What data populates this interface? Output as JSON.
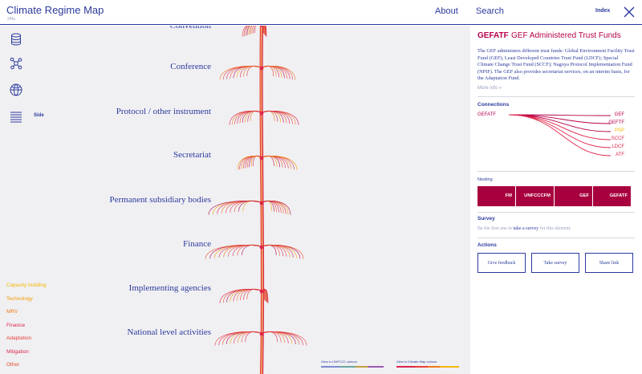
{
  "header": {
    "title": "Climate Regime Map",
    "subtitle": "24fa",
    "about_label": "About",
    "search_label": "Search",
    "index_label": "Index"
  },
  "sidebar": {
    "icons": [
      "database-icon",
      "network-icon",
      "globe-icon",
      "list-icon"
    ],
    "side_label": "Side"
  },
  "map": {
    "levels": [
      {
        "label": "Convention"
      },
      {
        "label": "Conference"
      },
      {
        "label": "Protocol / other instrument"
      },
      {
        "label": "Secretariat"
      },
      {
        "label": "Permanent subsidiary bodies"
      },
      {
        "label": "Finance"
      },
      {
        "label": "Implementing agencies"
      },
      {
        "label": "National level activities"
      }
    ],
    "view_unfccc_label": "View in UNFCCC colours",
    "view_crm_label": "View in Climate Map colours"
  },
  "legend": [
    {
      "label": "Capacity building",
      "color": "#f5b800"
    },
    {
      "label": "Technology",
      "color": "#f59a00"
    },
    {
      "label": "MRV",
      "color": "#ef7a1a"
    },
    {
      "label": "Finance",
      "color": "#e0264a"
    },
    {
      "label": "Adaptation",
      "color": "#e8403c"
    },
    {
      "label": "Mitigation",
      "color": "#d9254d"
    },
    {
      "label": "Other",
      "color": "#e84f2a"
    }
  ],
  "panel": {
    "code": "GEFATF",
    "name": "GEF Administered Trust Funds",
    "description": "The GEF administers different trust funds: Global Environment Facility Trust Fund (GEF); Least Developed Countries Trust Fund (LDCF); Special Climate Change Trust Fund (SCCF); Nagoya Protocol Implementation Fund (NPIF). The GEF also provides secretariat services, on an interim basis, for the Adaptation Fund.",
    "more_info": "More info »",
    "connections_title": "Connections",
    "connection_source": "GEFATF",
    "connections": [
      {
        "label": "GEF",
        "color": "#b5004a"
      },
      {
        "label": "GEFTF",
        "color": "#b5004a"
      },
      {
        "label": "PSP",
        "color": "#f5b800"
      },
      {
        "label": "SCCF",
        "color": "#e0264a"
      },
      {
        "label": "LDCF",
        "color": "#e0264a"
      },
      {
        "label": "ATF",
        "color": "#e0264a"
      }
    ],
    "nesting_title": "Nesting",
    "nesting": [
      "FM",
      "UNFCCCFM",
      "GEF",
      "GEFATF"
    ],
    "survey_title": "Survey",
    "survey_pre": "Be the first one to ",
    "survey_link": "take a survey",
    "survey_post": " for this element.",
    "actions_title": "Actions",
    "actions": [
      "Give feedback",
      "Take survey",
      "Share link"
    ]
  },
  "colors": {
    "accent": "#2b3a9c",
    "selected": "#b5004a",
    "map_background": "#f0f0f3"
  }
}
